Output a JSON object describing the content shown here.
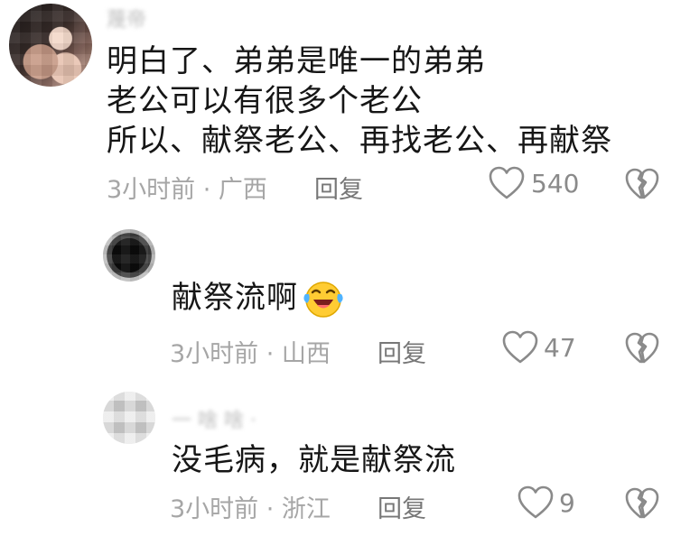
{
  "comments": [
    {
      "username": "蔑帝",
      "lines": [
        "明白了、弟弟是唯一的弟弟",
        "老公可以有很多个老公",
        "所以、献祭老公、再找老公、再献祭"
      ],
      "meta": "3小时前 · 广西",
      "reply_label": "回复",
      "like_count": "540",
      "like_icon": "heart-outline-icon",
      "dislike_icon": "broken-heart-icon"
    },
    {
      "username": "",
      "text": "献祭流啊",
      "emoji": "laughing-crying-emoji",
      "meta": "3小时前 · 山西",
      "reply_label": "回复",
      "like_count": "47",
      "like_icon": "heart-outline-icon",
      "dislike_icon": "broken-heart-icon"
    },
    {
      "username": "一 啥 啥 ·",
      "text": "没毛病，就是献祭流",
      "meta": "3小时前 · 浙江",
      "reply_label": "回复",
      "like_count": "9",
      "like_icon": "heart-outline-icon",
      "dislike_icon": "broken-heart-icon"
    }
  ],
  "colors": {
    "text": "#161616",
    "meta": "#a6a6a6",
    "reply": "#777777",
    "icon": "#8a8a8a",
    "background": "#ffffff"
  }
}
